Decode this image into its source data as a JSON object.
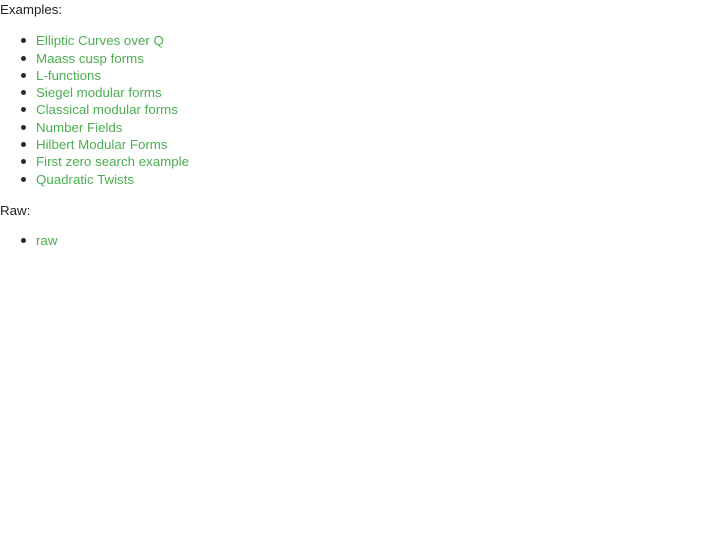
{
  "page": {
    "background_color": "#ffffff",
    "text_color": "#222222",
    "link_color": "#4CAE52",
    "bullet_color": "#2b2b2b"
  },
  "examples_section": {
    "label": "Examples:",
    "bullet_icon": "disc-bullet-icon",
    "items": [
      {
        "label": "Elliptic Curves over Q"
      },
      {
        "label": "Maass cusp forms"
      },
      {
        "label": "L-functions"
      },
      {
        "label": "Siegel modular forms"
      },
      {
        "label": "Classical modular forms"
      },
      {
        "label": "Number Fields"
      },
      {
        "label": "Hilbert Modular Forms"
      },
      {
        "label": "First zero search example"
      },
      {
        "label": "Quadratic Twists"
      }
    ]
  },
  "raw_section": {
    "label": "Raw:",
    "bullet_icon": "disc-bullet-icon",
    "items": [
      {
        "label": "raw"
      }
    ]
  }
}
